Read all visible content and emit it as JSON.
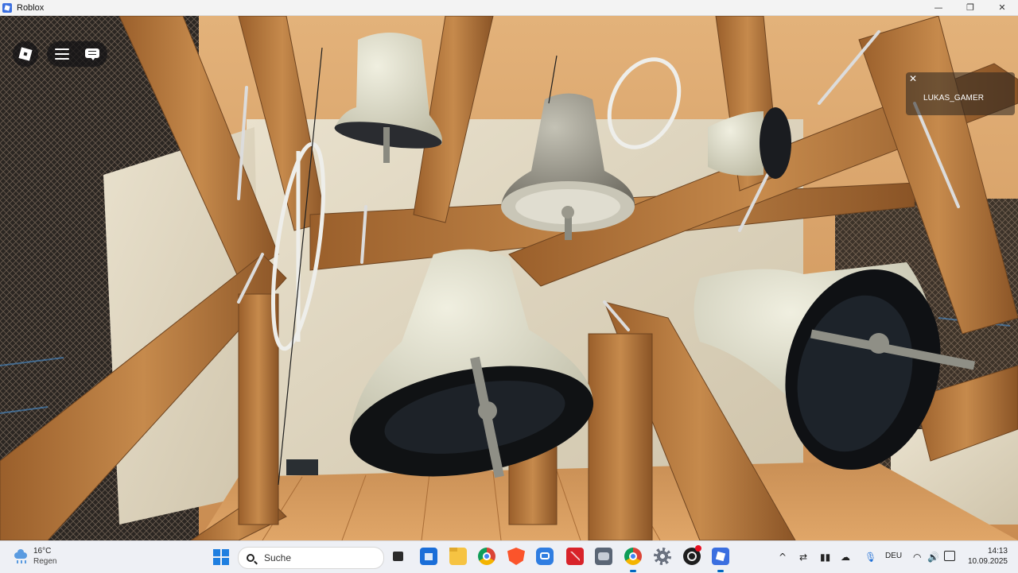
{
  "window": {
    "title": "Roblox",
    "controls": {
      "minimize": "—",
      "maximize": "❐",
      "close": "✕"
    }
  },
  "game": {
    "player_list": {
      "close_glyph": "✕",
      "players": [
        "LUKAS_GAMER"
      ]
    },
    "menu_icons": [
      "roblox-logo-icon",
      "hamburger-menu-icon",
      "chat-icon"
    ]
  },
  "taskbar": {
    "weather": {
      "temp": "16°C",
      "condition": "Regen"
    },
    "search": {
      "placeholder": "Suche"
    },
    "apps": [
      "task-view",
      "microsoft-store",
      "file-explorer",
      "chrome",
      "brave",
      "chat-app",
      "pdf-app",
      "game-app",
      "chrome-profile",
      "settings",
      "obs-studio",
      "roblox"
    ],
    "tray": {
      "chevron": "^",
      "language": "DEU"
    },
    "clock": {
      "time": "14:13",
      "date": "10.09.2025"
    }
  },
  "colors": {
    "accent": "#0067c0",
    "roblox_blue": "#3b6fe0",
    "wood": "#b5773c",
    "bell": "#e2e1cf"
  }
}
